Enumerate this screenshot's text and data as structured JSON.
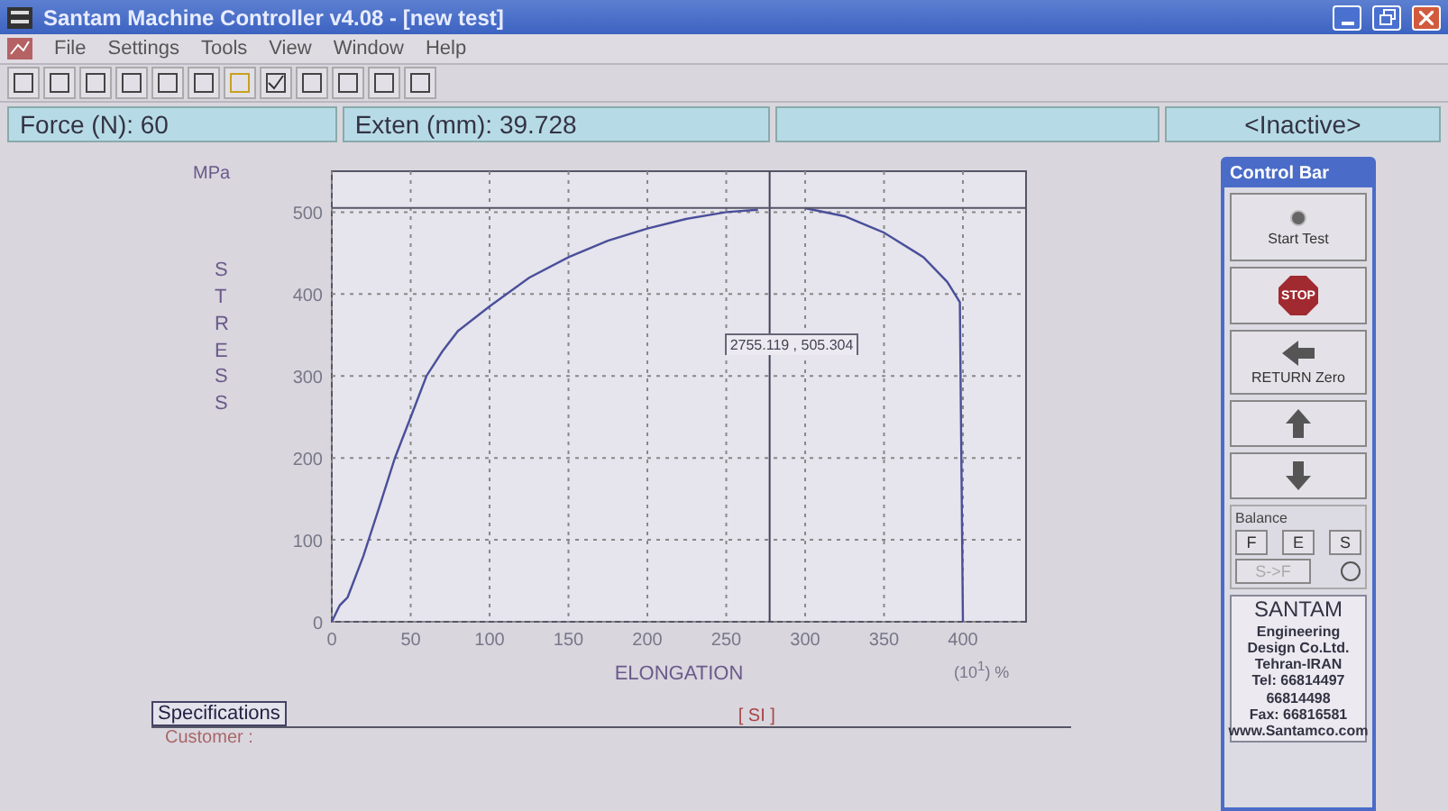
{
  "window": {
    "title": "Santam Machine Controller v4.08 - [new test]"
  },
  "menu": [
    "File",
    "Settings",
    "Tools",
    "View",
    "Window",
    "Help"
  ],
  "status_bar": {
    "force": "Force (N): 60",
    "extension": "Exten (mm): 39.728",
    "state": "<Inactive>"
  },
  "chart": {
    "unit_y": "MPa",
    "unit_x": "(10$^{1}$) %",
    "chart_data": {
      "type": "line",
      "xlabel": "ELONGATION",
      "ylabel": "STRESS",
      "xlim": [
        0,
        440
      ],
      "ylim": [
        0,
        550
      ],
      "xticks": [
        0,
        50,
        100,
        150,
        200,
        250,
        300,
        350,
        400
      ],
      "yticks": [
        0,
        100,
        200,
        300,
        400,
        500
      ],
      "grid": true,
      "x": [
        0,
        5,
        10,
        20,
        30,
        40,
        50,
        60,
        70,
        80,
        100,
        125,
        150,
        175,
        200,
        225,
        250,
        270,
        300,
        325,
        350,
        375,
        390,
        398,
        400
      ],
      "series": [
        {
          "color": "#4a4f9a",
          "values": [
            0,
            20,
            30,
            80,
            140,
            200,
            250,
            300,
            330,
            355,
            385,
            420,
            445,
            465,
            480,
            492,
            500,
            503,
            null,
            null,
            null,
            null,
            null,
            null,
            null
          ]
        },
        {
          "color": "#4a4f9a",
          "values": [
            null,
            null,
            null,
            null,
            null,
            null,
            null,
            null,
            null,
            null,
            null,
            null,
            null,
            null,
            null,
            null,
            null,
            null,
            505,
            495,
            475,
            445,
            415,
            390,
            0
          ]
        }
      ],
      "ref_lines": [
        {
          "axis": "x",
          "value": 277.5
        },
        {
          "axis": "y",
          "value": 505.3
        }
      ],
      "annotations": [
        "2755.119 , 505.304"
      ]
    }
  },
  "control_bar": {
    "title": "Control Bar",
    "buttons": [
      {
        "kind": "start",
        "label": "Start Test"
      },
      {
        "kind": "stop",
        "label": "STOP"
      },
      {
        "kind": "return",
        "label": "RETURN Zero"
      },
      {
        "kind": "up"
      },
      {
        "kind": "down"
      }
    ],
    "balance": {
      "title": "Balance",
      "buttons": [
        {
          "label": "F",
          "disabled": false
        },
        {
          "label": "E",
          "disabled": false
        },
        {
          "label": "S",
          "disabled": false
        },
        {
          "label": "S->F",
          "disabled": true
        }
      ],
      "indicator": {
        "on": false
      }
    },
    "company": [
      "SANTAM",
      "Engineering",
      "Design Co.Ltd.",
      "Tehran-IRAN",
      "Tel: 66814497",
      "66814498",
      "Fax: 66816581",
      "www.Santamco.com"
    ]
  },
  "specifications": {
    "title": "Specifications",
    "units": "[ SI ]",
    "fields": [
      "Customer :"
    ]
  }
}
